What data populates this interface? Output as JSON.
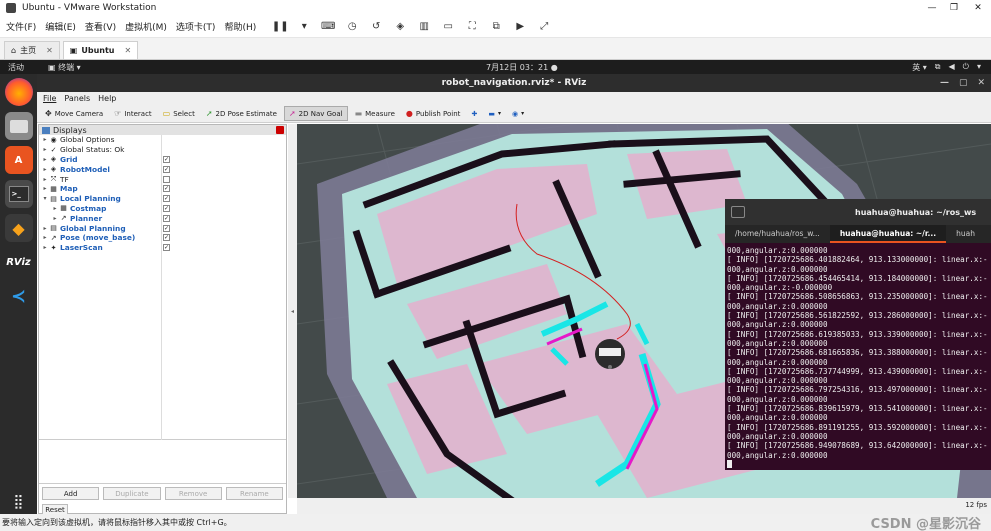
{
  "vmware": {
    "title": "Ubuntu - VMware Workstation",
    "menu": [
      "文件(F)",
      "编辑(E)",
      "查看(V)",
      "虚拟机(M)",
      "选项卡(T)",
      "帮助(H)"
    ],
    "tabs": [
      {
        "label": "主页"
      },
      {
        "label": "Ubuntu"
      }
    ],
    "status_text": "要将输入定向到该虚拟机，请将鼠标指针移入其中或按 Ctrl+G。",
    "watermark": "CSDN @星影沉谷"
  },
  "ubuntu_bar": {
    "activities": "活动",
    "app": "终端",
    "clock": "7月12日  03：21",
    "lang": "英"
  },
  "dock": [
    "firefox-icon",
    "files-icon",
    "software-icon",
    "terminal-icon",
    "stack-icon",
    "rviz-icon",
    "vscode-icon"
  ],
  "dock_rviz_label": "RViz",
  "rviz": {
    "title": "robot_navigation.rviz* - RViz",
    "menu": [
      "File",
      "Panels",
      "Help"
    ],
    "tools": [
      {
        "label": "Move Camera",
        "icon": "✥"
      },
      {
        "label": "Interact",
        "icon": "☞"
      },
      {
        "label": "Select",
        "icon": "▭"
      },
      {
        "label": "2D Pose Estimate",
        "icon": "➚"
      },
      {
        "label": "2D Nav Goal",
        "icon": "➚"
      },
      {
        "label": "Measure",
        "icon": "▬"
      },
      {
        "label": "Publish Point",
        "icon": "●"
      }
    ],
    "displays_title": "Displays",
    "displays": [
      {
        "label": "Global Options",
        "icon": "◉",
        "arrow": "▸",
        "indent": 0,
        "blue": false,
        "check": null
      },
      {
        "label": "Global Status: Ok",
        "icon": "✓",
        "arrow": "▸",
        "indent": 0,
        "blue": false,
        "check": null
      },
      {
        "label": "Grid",
        "icon": "◈",
        "arrow": "▸",
        "indent": 0,
        "blue": true,
        "check": "✓"
      },
      {
        "label": "RobotModel",
        "icon": "◈",
        "arrow": "▸",
        "indent": 0,
        "blue": true,
        "check": "✓"
      },
      {
        "label": "TF",
        "icon": "⤧",
        "arrow": "▸",
        "indent": 0,
        "blue": false,
        "check": ""
      },
      {
        "label": "Map",
        "icon": "▦",
        "arrow": "▸",
        "indent": 0,
        "blue": true,
        "check": "✓"
      },
      {
        "label": "Local Planning",
        "icon": "▤",
        "arrow": "▾",
        "indent": 0,
        "blue": true,
        "check": "✓"
      },
      {
        "label": "Costmap",
        "icon": "▦",
        "arrow": "▸",
        "indent": 1,
        "blue": true,
        "check": "✓"
      },
      {
        "label": "Planner",
        "icon": "↗",
        "arrow": "▸",
        "indent": 1,
        "blue": true,
        "check": "✓"
      },
      {
        "label": "Global Planning",
        "icon": "▤",
        "arrow": "▸",
        "indent": 0,
        "blue": true,
        "check": "✓"
      },
      {
        "label": "Pose (move_base)",
        "icon": "↗",
        "arrow": "▸",
        "indent": 0,
        "blue": true,
        "check": "✓"
      },
      {
        "label": "LaserScan",
        "icon": "✦",
        "arrow": "▸",
        "indent": 0,
        "blue": true,
        "check": "✓"
      }
    ],
    "buttons": {
      "add": "Add",
      "duplicate": "Duplicate",
      "remove": "Remove",
      "rename": "Rename",
      "reset": "Reset"
    },
    "fps": "12 fps"
  },
  "terminal": {
    "title": "huahua@huahua: ~/ros_ws",
    "tabs": [
      "/home/huahua/ros_w...",
      "huahua@huahua: ~/r...",
      "huah"
    ],
    "lines": [
      "000,angular.z:0.000000",
      "[ INFO] [1720725686.401882464, 913.133000000]: linear.x:-",
      "000,angular.z:0.000000",
      "[ INFO] [1720725686.454465414, 913.184000000]: linear.x:-",
      "000,angular.z:-0.000000",
      "[ INFO] [1720725686.508656863, 913.235000000]: linear.x:-",
      "000,angular.z:0.000000",
      "[ INFO] [1720725686.561822592, 913.286000000]: linear.x:-",
      "000,angular.z:0.000000",
      "[ INFO] [1720725686.619385033, 913.339000000]: linear.x:-",
      "000,angular.z:0.000000",
      "[ INFO] [1720725686.681665836, 913.388000000]: linear.x:-",
      "000,angular.z:0.000000",
      "[ INFO] [1720725686.737744999, 913.439000000]: linear.x:-",
      "000,angular.z:0.000000",
      "[ INFO] [1720725686.797254316, 913.497000000]: linear.x:-",
      "000,angular.z:0.000000",
      "[ INFO] [1720725686.839615979, 913.541000000]: linear.x:-",
      "000,angular.z:0.000000",
      "[ INFO] [1720725686.891191255, 913.592000000]: linear.x:-",
      "000,angular.z:0.000000",
      "[ INFO] [1720725686.949078689, 913.642000000]: linear.x:-",
      "000,angular.z:0.000000"
    ]
  },
  "colors": {
    "map_bg": "#434a4a",
    "costmap_light": "#b3e0da",
    "inflation_pink": "#ddb7cf",
    "obstacle": "#1a0f1a",
    "laser_cyan": "#19e6e6",
    "laser_magenta": "#e619c8",
    "path_red": "#d42020",
    "terminal_bg": "#300a24"
  }
}
